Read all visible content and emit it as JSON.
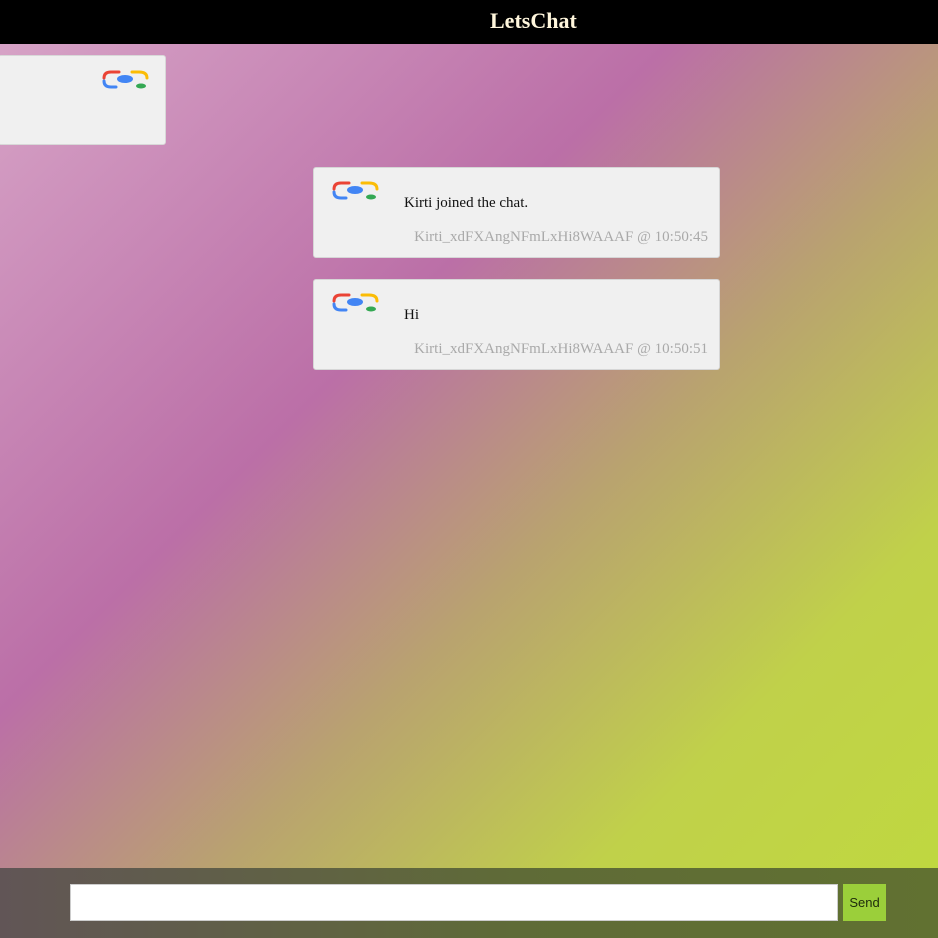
{
  "app": {
    "title": "LetsChat"
  },
  "messages": [
    {
      "text": "Kirti joined the chat.",
      "meta": "Kirti_xdFXAngNFmLxHi8WAAAF @ 10:50:45",
      "avatar_icon": "google-lens-icon"
    },
    {
      "text": "Hi",
      "meta": "Kirti_xdFXAngNFmLxHi8WAAAF @ 10:50:51",
      "avatar_icon": "google-lens-icon"
    }
  ],
  "side_panel": {
    "avatar_icon": "google-lens-icon"
  },
  "composer": {
    "input_value": "",
    "input_placeholder": "",
    "send_label": "Send"
  },
  "colors": {
    "header_bg": "#000000",
    "title_color": "#fff6dc",
    "bubble_bg": "#f0f0f0",
    "meta_color": "#a9a9a9",
    "send_button": "#9bcf3a"
  }
}
